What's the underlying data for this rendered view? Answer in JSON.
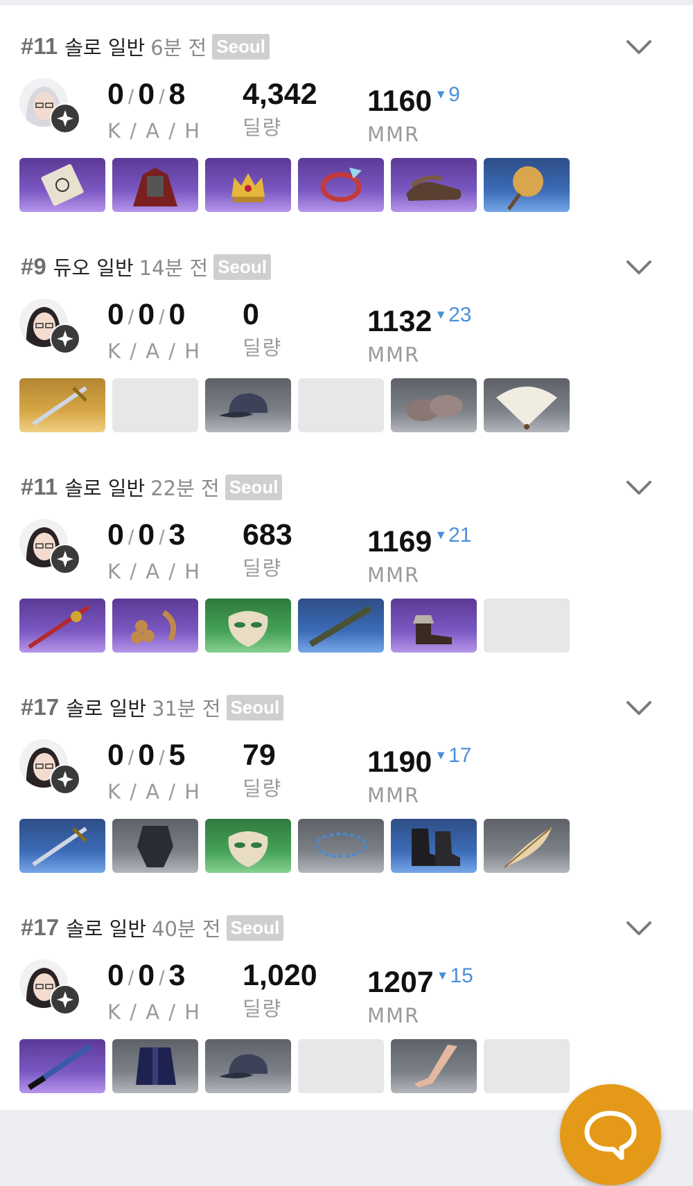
{
  "labels": {
    "kah": "K / A / H",
    "damage": "딜량",
    "mmr": "MMR"
  },
  "matches": [
    {
      "rank": "#11",
      "mode": "솔로 일반",
      "time": "6분 전",
      "server": "Seoul",
      "k": "0",
      "a": "0",
      "h": "8",
      "damage": "4,342",
      "mmr": "1160",
      "mmr_delta": "9",
      "mmr_trend": "down",
      "items": [
        {
          "icon": "scroll-item-icon",
          "grade": "purple"
        },
        {
          "icon": "armor-item-icon",
          "grade": "purple"
        },
        {
          "icon": "crown-item-icon",
          "grade": "purple"
        },
        {
          "icon": "bracelet-item-icon",
          "grade": "purple"
        },
        {
          "icon": "shoes-item-icon",
          "grade": "purple"
        },
        {
          "icon": "hand-fan-item-icon",
          "grade": "blue"
        }
      ]
    },
    {
      "rank": "#9",
      "mode": "듀오 일반",
      "time": "14분 전",
      "server": "Seoul",
      "k": "0",
      "a": "0",
      "h": "0",
      "damage": "0",
      "mmr": "1132",
      "mmr_delta": "23",
      "mmr_trend": "down",
      "items": [
        {
          "icon": "sword-item-icon",
          "grade": "gold"
        },
        {
          "icon": "empty-slot",
          "grade": "empty"
        },
        {
          "icon": "cap-item-icon",
          "grade": "gray"
        },
        {
          "icon": "empty-slot",
          "grade": "empty"
        },
        {
          "icon": "slippers-item-icon",
          "grade": "gray"
        },
        {
          "icon": "folding-fan-item-icon",
          "grade": "gray"
        }
      ]
    },
    {
      "rank": "#11",
      "mode": "솔로 일반",
      "time": "22분 전",
      "server": "Seoul",
      "k": "0",
      "a": "0",
      "h": "3",
      "damage": "683",
      "mmr": "1169",
      "mmr_delta": "21",
      "mmr_trend": "down",
      "items": [
        {
          "icon": "rapier-item-icon",
          "grade": "purple"
        },
        {
          "icon": "grapes-item-icon",
          "grade": "purple"
        },
        {
          "icon": "mask-item-icon",
          "grade": "green"
        },
        {
          "icon": "sheath-item-icon",
          "grade": "blue"
        },
        {
          "icon": "boots-item-icon",
          "grade": "purple"
        },
        {
          "icon": "empty-slot",
          "grade": "empty"
        }
      ]
    },
    {
      "rank": "#17",
      "mode": "솔로 일반",
      "time": "31분 전",
      "server": "Seoul",
      "k": "0",
      "a": "0",
      "h": "5",
      "damage": "79",
      "mmr": "1190",
      "mmr_delta": "17",
      "mmr_trend": "down",
      "items": [
        {
          "icon": "sword-item-icon",
          "grade": "blue"
        },
        {
          "icon": "suit-item-icon",
          "grade": "gray"
        },
        {
          "icon": "mask-item-icon",
          "grade": "green"
        },
        {
          "icon": "necklace-item-icon",
          "grade": "gray"
        },
        {
          "icon": "combat-boots-item-icon",
          "grade": "blue"
        },
        {
          "icon": "feather-item-icon",
          "grade": "gray"
        }
      ]
    },
    {
      "rank": "#17",
      "mode": "솔로 일반",
      "time": "40분 전",
      "server": "Seoul",
      "k": "0",
      "a": "0",
      "h": "3",
      "damage": "1,020",
      "mmr": "1207",
      "mmr_delta": "15",
      "mmr_trend": "down",
      "items": [
        {
          "icon": "spiked-blade-item-icon",
          "grade": "purple"
        },
        {
          "icon": "jacket-item-icon",
          "grade": "gray"
        },
        {
          "icon": "cap-item-icon",
          "grade": "gray"
        },
        {
          "icon": "empty-slot",
          "grade": "empty"
        },
        {
          "icon": "stockings-item-icon",
          "grade": "gray"
        },
        {
          "icon": "empty-slot",
          "grade": "empty"
        }
      ]
    }
  ],
  "fab": {
    "icon": "chat-bubble-icon"
  },
  "colors": {
    "delta": "#4a90d9",
    "fab": "#e49a18",
    "server_badge": "#cfcfcf"
  }
}
